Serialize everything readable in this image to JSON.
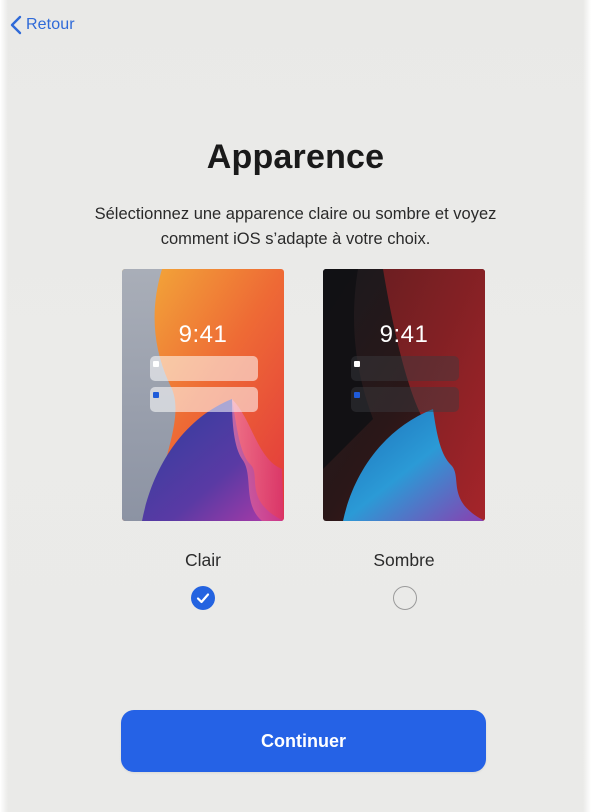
{
  "nav": {
    "back_label": "Retour"
  },
  "header": {
    "title": "Apparence",
    "subtitle": "Sélectionnez une apparence claire ou sombre et voyez comment iOS s’adapte à votre choix."
  },
  "options": [
    {
      "label": "Clair",
      "clock": "9:41",
      "selected": true
    },
    {
      "label": "Sombre",
      "clock": "9:41",
      "selected": false
    }
  ],
  "actions": {
    "continue_label": "Continuer"
  },
  "colors": {
    "accent": "#2562e6",
    "link": "#2f6ad8",
    "background": "#eaeae8",
    "title_text": "#1a1a1a"
  },
  "icons": {
    "back": "chevron-left-icon",
    "selected": "checkmark-icon"
  }
}
